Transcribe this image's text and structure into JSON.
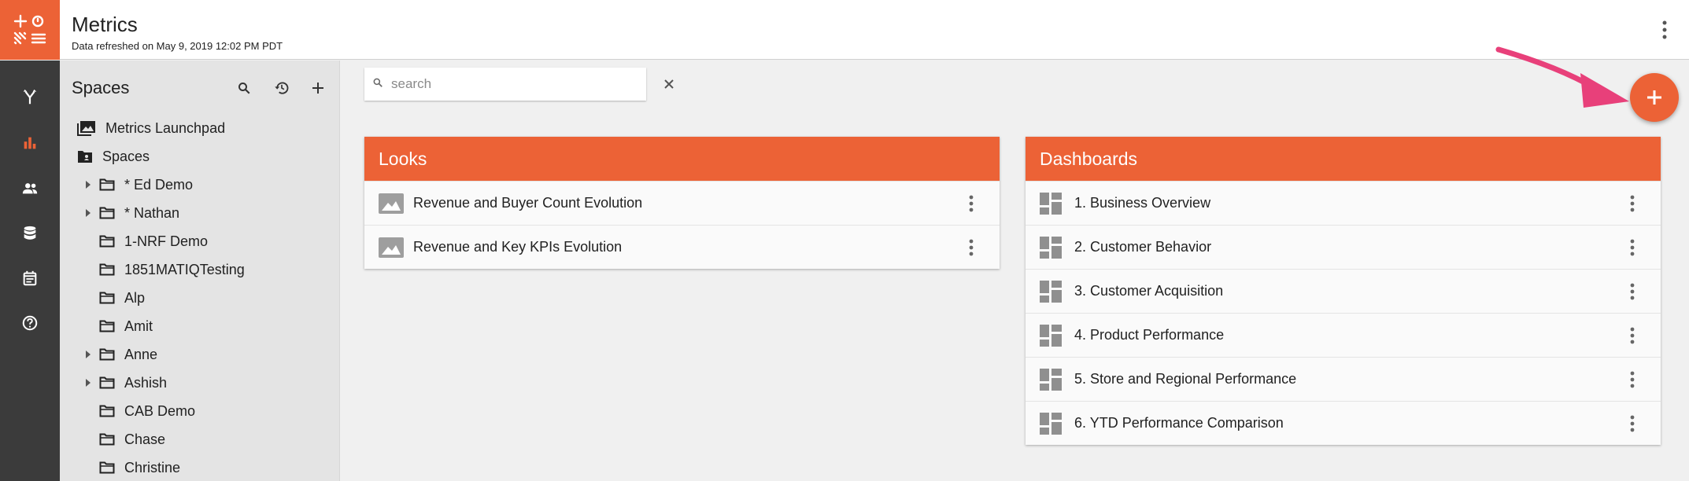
{
  "header": {
    "title": "Metrics",
    "subtitle": "Data refreshed on May 9, 2019 12:02 PM PDT"
  },
  "rail": {
    "items": [
      {
        "icon": "share-branch-icon"
      },
      {
        "icon": "bar-chart-icon",
        "active": true
      },
      {
        "icon": "people-icon"
      },
      {
        "icon": "database-icon"
      },
      {
        "icon": "calendar-icon"
      },
      {
        "icon": "help-icon"
      }
    ]
  },
  "spaces": {
    "title": "Spaces",
    "tree": [
      {
        "label": "Metrics Launchpad",
        "icon": "photo-library-icon"
      },
      {
        "label": "Spaces",
        "icon": "folder-shared-icon"
      },
      {
        "label": "* Ed Demo",
        "expandable": true
      },
      {
        "label": "* Nathan",
        "expandable": true
      },
      {
        "label": "1-NRF Demo"
      },
      {
        "label": "1851MATIQTesting"
      },
      {
        "label": "Alp"
      },
      {
        "label": "Amit"
      },
      {
        "label": "Anne",
        "expandable": true
      },
      {
        "label": "Ashish",
        "expandable": true
      },
      {
        "label": "CAB Demo"
      },
      {
        "label": "Chase"
      },
      {
        "label": "Christine"
      }
    ]
  },
  "search": {
    "placeholder": "search",
    "value": ""
  },
  "looks": {
    "title": "Looks",
    "items": [
      {
        "label": "Revenue and Buyer Count Evolution"
      },
      {
        "label": "Revenue and Key KPIs Evolution"
      }
    ]
  },
  "dashboards": {
    "title": "Dashboards",
    "items": [
      {
        "label": "1. Business Overview"
      },
      {
        "label": "2. Customer Behavior"
      },
      {
        "label": "3. Customer Acquisition"
      },
      {
        "label": "4. Product Performance"
      },
      {
        "label": "5. Store and Regional Performance"
      },
      {
        "label": "6. YTD Performance Comparison"
      }
    ]
  },
  "colors": {
    "accent": "#ec6236",
    "rail": "#3b3b3b",
    "annotation_arrow": "#e8407a"
  }
}
